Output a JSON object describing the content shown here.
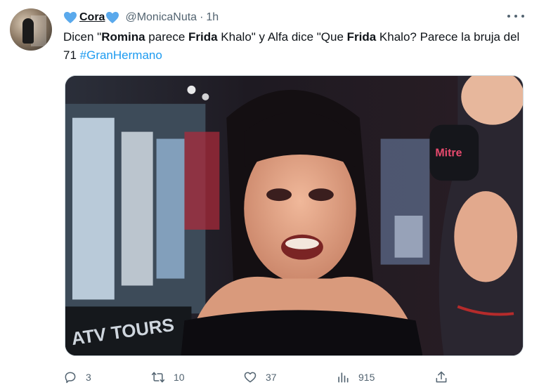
{
  "tweet": {
    "display_name": "Cora",
    "handle": "@MonicaNuta",
    "separator": "·",
    "time": "1h",
    "text_parts": {
      "p1": "Dicen \"",
      "b1": "Romina",
      "p2": " parece ",
      "b2": "Frida",
      "p3": " Khalo\" y Alfa dice \"Que ",
      "b3": "Frida",
      "p4": " Khalo? Parece la bruja del 71 ",
      "hashtag": "#GranHermano"
    },
    "media": {
      "sign_text": "ATV TOURS",
      "mic_logo": "Mitre"
    },
    "actions": {
      "reply_count": "3",
      "retweet_count": "10",
      "like_count": "37",
      "views_count": "915"
    }
  },
  "icons": {
    "name_decoration": "blue-heart-icon",
    "reply": "reply-icon",
    "retweet": "retweet-icon",
    "like": "like-icon",
    "views": "views-icon",
    "share": "share-icon",
    "more": "more-icon"
  },
  "colors": {
    "accent": "#1d9bf0",
    "secondary_text": "#536471",
    "heart": "#5aa9ec"
  }
}
